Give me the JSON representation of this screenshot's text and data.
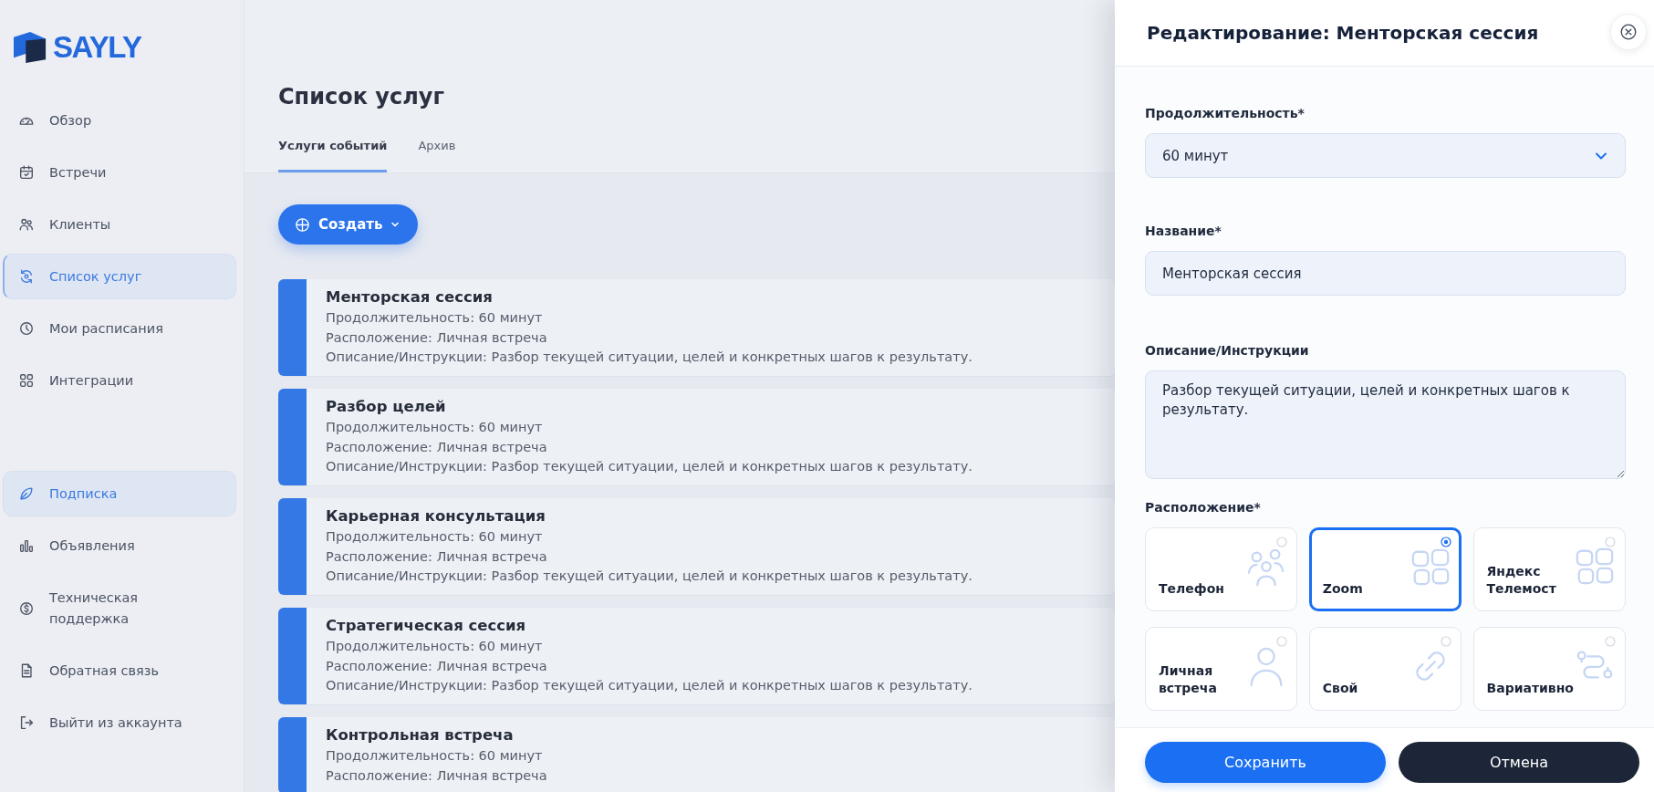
{
  "sidebar": {
    "logo_text": "SAYLY",
    "nav": [
      {
        "label": "Обзор",
        "selected": false
      },
      {
        "label": "Встречи",
        "selected": false
      },
      {
        "label": "Клиенты",
        "selected": false
      },
      {
        "label": "Список услуг",
        "selected": true
      },
      {
        "label": "Мои расписания",
        "selected": false
      },
      {
        "label": "Интеграции",
        "selected": false
      }
    ],
    "secondary_nav": [
      {
        "label": "Подписка",
        "selected": true
      },
      {
        "label": "Объявления",
        "selected": false
      },
      {
        "label": "Техническая поддержка",
        "selected": false
      },
      {
        "label": "Обратная связь",
        "selected": false
      },
      {
        "label": "Выйти из аккаунта",
        "selected": false
      }
    ]
  },
  "page": {
    "title": "Список услуг",
    "tabs": [
      {
        "label": "Услуги событий",
        "selected": true
      },
      {
        "label": "Архив",
        "selected": false
      }
    ],
    "create_button": "Создать",
    "services": [
      {
        "title": "Менторская сессия",
        "lines": [
          "Продолжительность: 60 минут",
          "Расположение: Личная встреча",
          "Описание/Инструкции: Разбор текущей ситуации, целей и конкретных шагов к результату."
        ]
      },
      {
        "title": "Разбор целей",
        "lines": [
          "Продолжительность: 60 минут",
          "Расположение: Личная встреча",
          "Описание/Инструкции: Разбор текущей ситуации, целей и конкретных шагов к результату."
        ]
      },
      {
        "title": "Карьерная консультация",
        "lines": [
          "Продолжительность: 60 минут",
          "Расположение: Личная встреча",
          "Описание/Инструкции: Разбор текущей ситуации, целей и конкретных шагов к результату."
        ]
      },
      {
        "title": "Стратегическая сессия",
        "lines": [
          "Продолжительность: 60 минут",
          "Расположение: Личная встреча",
          "Описание/Инструкции: Разбор текущей ситуации, целей и конкретных шагов к результату."
        ]
      },
      {
        "title": "Контрольная встреча",
        "lines": [
          "Продолжительность: 60 минут",
          "Расположение: Личная встреча"
        ]
      }
    ]
  },
  "edit_panel": {
    "title": "Редактирование: Менторская сессия",
    "duration": {
      "label": "Продолжительность*",
      "value": "60 минут"
    },
    "name": {
      "label": "Название*",
      "value": "Менторская сессия"
    },
    "description": {
      "label": "Описание/Инструкции",
      "value": "Разбор текущей ситуации, целей и конкретных шагов к результату."
    },
    "location": {
      "label": "Расположение*",
      "options": [
        {
          "label": "Телефон",
          "selected": false
        },
        {
          "label": "Zoom",
          "selected": true
        },
        {
          "label": "Яндекс Телемост",
          "selected": false
        },
        {
          "label": "Личная встреча",
          "selected": false
        },
        {
          "label": "Свой",
          "selected": false
        },
        {
          "label": "Вариативно",
          "selected": false
        }
      ]
    },
    "buttons": [
      {
        "label": "Сохранить",
        "kind": "primary"
      },
      {
        "label": "Отмена",
        "kind": "secondary"
      }
    ]
  }
}
